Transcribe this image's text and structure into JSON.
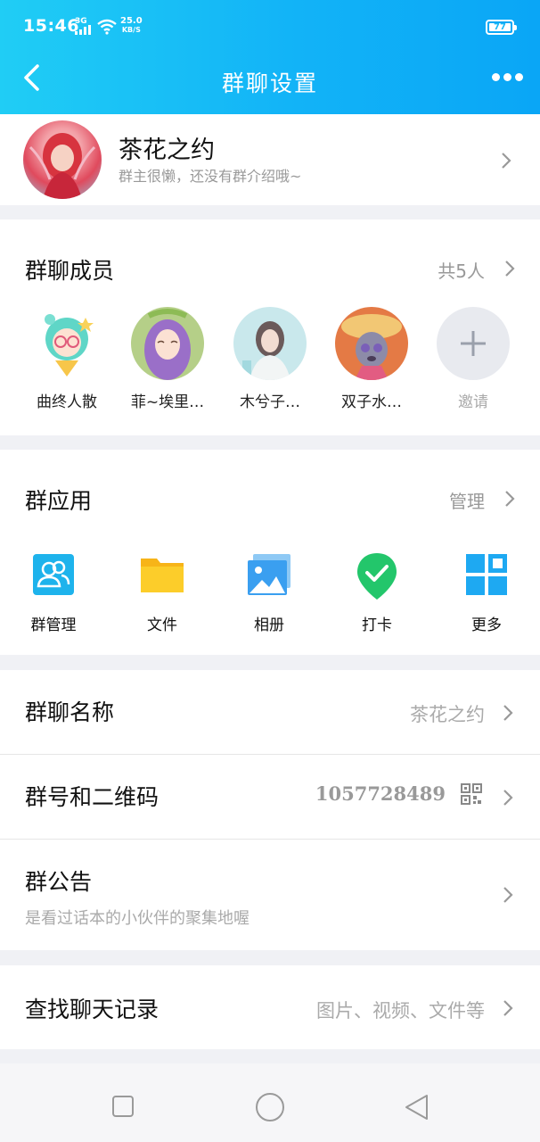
{
  "status_bar": {
    "time": "15:46",
    "network": "3G",
    "speed_value": "25.0",
    "speed_unit": "KB/S",
    "battery": "77"
  },
  "nav": {
    "title": "群聊设置",
    "back_icon": "chevron-left-icon",
    "more_icon": "more-dots-icon"
  },
  "group": {
    "name": "茶花之约",
    "description": "群主很懒，还没有群介绍哦~"
  },
  "members": {
    "title": "群聊成员",
    "count": "共5人",
    "list": [
      {
        "name": "曲终人散"
      },
      {
        "name": "菲~埃里…"
      },
      {
        "name": "木兮子…"
      },
      {
        "name": "双子水…"
      }
    ],
    "invite_label": "邀请"
  },
  "apps": {
    "title": "群应用",
    "manage_label": "管理",
    "items": [
      {
        "label": "群管理",
        "icon": "group-manage-icon"
      },
      {
        "label": "文件",
        "icon": "folder-icon"
      },
      {
        "label": "相册",
        "icon": "album-icon"
      },
      {
        "label": "打卡",
        "icon": "checkin-icon"
      },
      {
        "label": "更多",
        "icon": "grid-more-icon"
      }
    ]
  },
  "settings": {
    "group_name_label": "群聊名称",
    "group_name_value": "茶花之约",
    "group_number_label": "群号和二维码",
    "group_number_value": "1057728489",
    "notice_label": "群公告",
    "notice_value": "是看过话本的小伙伴的聚集地喔",
    "search_label": "查找聊天记录",
    "search_value": "图片、视频、文件等"
  },
  "colors": {
    "header_start": "#20cdf5",
    "header_end": "#0aa6f6",
    "background": "#f0f1f5"
  }
}
